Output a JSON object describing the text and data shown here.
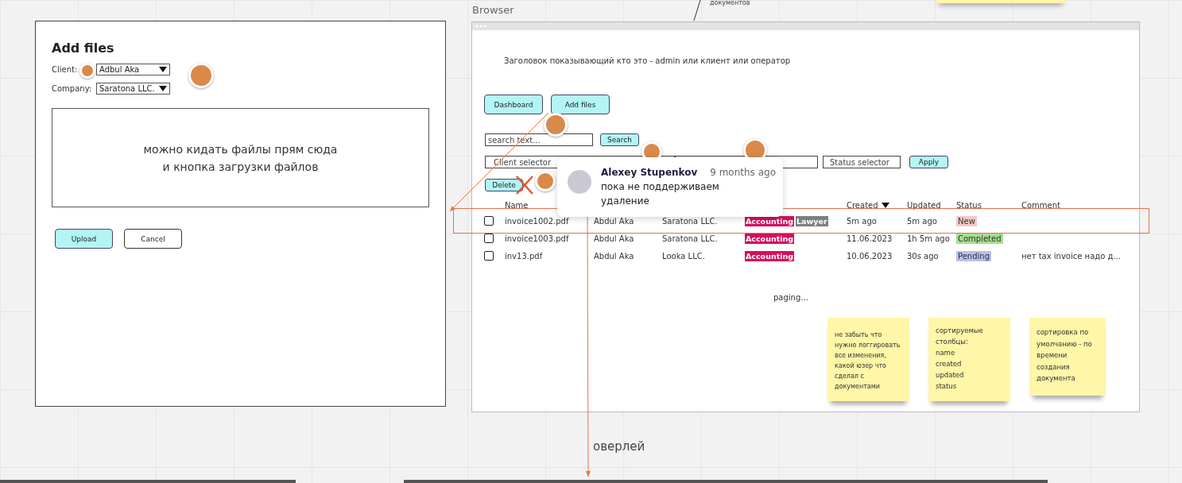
{
  "board_labels": {
    "browser": "Browser",
    "overlay": "оверлей",
    "top_note": "документов"
  },
  "add_files_frame": {
    "title": "Add files",
    "client": {
      "label": "Client:",
      "value": "Adbul Aka"
    },
    "company": {
      "label": "Company:",
      "value": "Saratona LLC."
    },
    "dropzone_text": [
      "можно кидать файлы прям сюда",
      "и кнопка загрузки файлов"
    ],
    "buttons": [
      {
        "label": "Upload",
        "primary": true
      },
      {
        "label": "Cancel",
        "primary": false
      }
    ]
  },
  "browser": {
    "heading": "Заголовок показывающий кто это - admin или клиент или оператор",
    "nav_buttons": [
      "Dashboard",
      "Add files"
    ],
    "search": {
      "placeholder": "search text...",
      "button": "Search"
    },
    "filters": {
      "client_placeholder": "Client selector",
      "status_placeholder": "Status selector",
      "button": "Apply"
    },
    "delete_button": {
      "label": "Delete",
      "crossed_out": true
    },
    "name_column": {
      "label": "Name",
      "sorted": false
    },
    "columns": [
      {
        "label": "Created",
        "sorted": true
      },
      {
        "label": "Updated",
        "sorted": false
      },
      {
        "label": "Status",
        "sorted": false
      },
      {
        "label": "Comment",
        "sorted": false
      }
    ],
    "rows": [
      {
        "checked": false,
        "highlighted": true,
        "name": "invoice1002.pdf",
        "client": "Abdul Aka",
        "company": "Saratona LLC.",
        "tags": [
          {
            "label": "Accounting",
            "color": "#d1105e"
          },
          {
            "label": "Lawyer",
            "color": "#7f7f7f"
          }
        ],
        "created": "5m ago",
        "updated": "5m ago",
        "status": {
          "label": "New",
          "color": "#f7c6c6"
        }
      },
      {
        "checked": false,
        "highlighted": false,
        "name": "invoice1003.pdf",
        "client": "Abdul Aka",
        "company": "Saratona LLC.",
        "tags": [
          {
            "label": "Accounting",
            "color": "#d1105e"
          }
        ],
        "created": "11.06.2023",
        "updated": "1h 5m ago",
        "status": {
          "label": "Completed",
          "color": "#a6dd8f"
        }
      },
      {
        "checked": false,
        "highlighted": false,
        "name": "inv13.pdf",
        "client": "Abdul Aka",
        "company": "Looka LLC.",
        "tags": [
          {
            "label": "Accounting",
            "color": "#d1105e"
          }
        ],
        "created": "10.06.2023",
        "updated": "30s ago",
        "status": {
          "label": "Pending",
          "color": "#b5c0ee"
        },
        "comment": "нет tax invoice надо д..."
      }
    ],
    "paging": "paging...",
    "stickies": [
      {
        "lines": [
          "не забыть что нужно логгировать все изменения, какой юзер что сделал с документами"
        ]
      },
      {
        "lines": [
          "сортируемые столбцы:",
          "name",
          "created",
          "updated",
          "status"
        ]
      },
      {
        "lines": [
          "сортировка по умолчанию - по времени создания документа"
        ]
      }
    ]
  },
  "comment_popup": {
    "author": "Alexey Stupenkov",
    "time": "9 months ago",
    "text": "пока не поддерживаем удаление"
  }
}
